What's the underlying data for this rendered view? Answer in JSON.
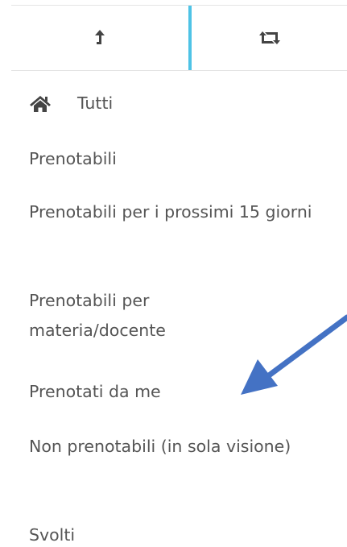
{
  "tabs": [
    {
      "icon": "upload-arrow-icon"
    },
    {
      "icon": "retweet-sync-icon"
    }
  ],
  "colors": {
    "active_divider": "#4ec3e6",
    "text": "#555555",
    "icon": "#444444",
    "annotation_arrow": "#4472c4"
  },
  "menu": {
    "tutti": {
      "label": "Tutti",
      "icon": "home-icon"
    },
    "prenotabili": "Prenotabili",
    "prossimi_15": "Prenotabili per i prossimi 15 giorni",
    "materia_docente": "Prenotabili per materia/docente",
    "prenotati_da_me": "Prenotati da me",
    "non_prenotabili": "Non prenotabili (in sola visione)",
    "svolti": "Svolti"
  },
  "annotation": {
    "icon": "pointer-arrow-icon"
  }
}
